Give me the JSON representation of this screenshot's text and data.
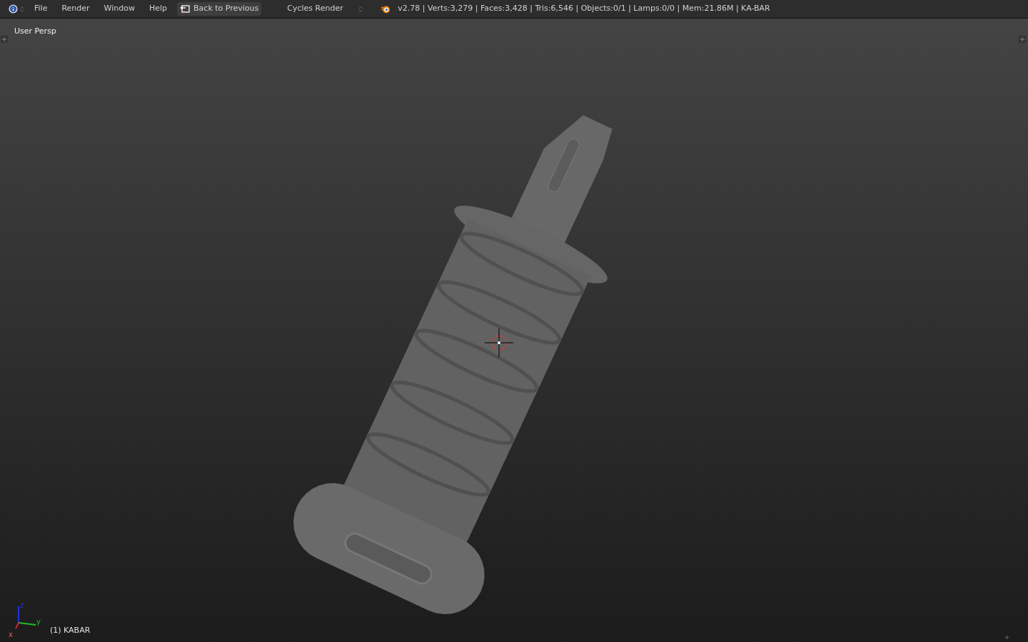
{
  "menu_bar": {
    "menus": [
      "File",
      "Render",
      "Window",
      "Help"
    ],
    "back_button": "Back to Previous",
    "render_engine": "Cycles Render",
    "stats": "v2.78 | Verts:3,279 | Faces:3,428 | Tris:6,546 | Objects:0/1 | Lamps:0/0 | Mem:21.86M | KA-BAR"
  },
  "viewport": {
    "view_name": "User Persp",
    "object_label": "(1) KABAR",
    "axes": [
      "x",
      "y",
      "z"
    ]
  }
}
